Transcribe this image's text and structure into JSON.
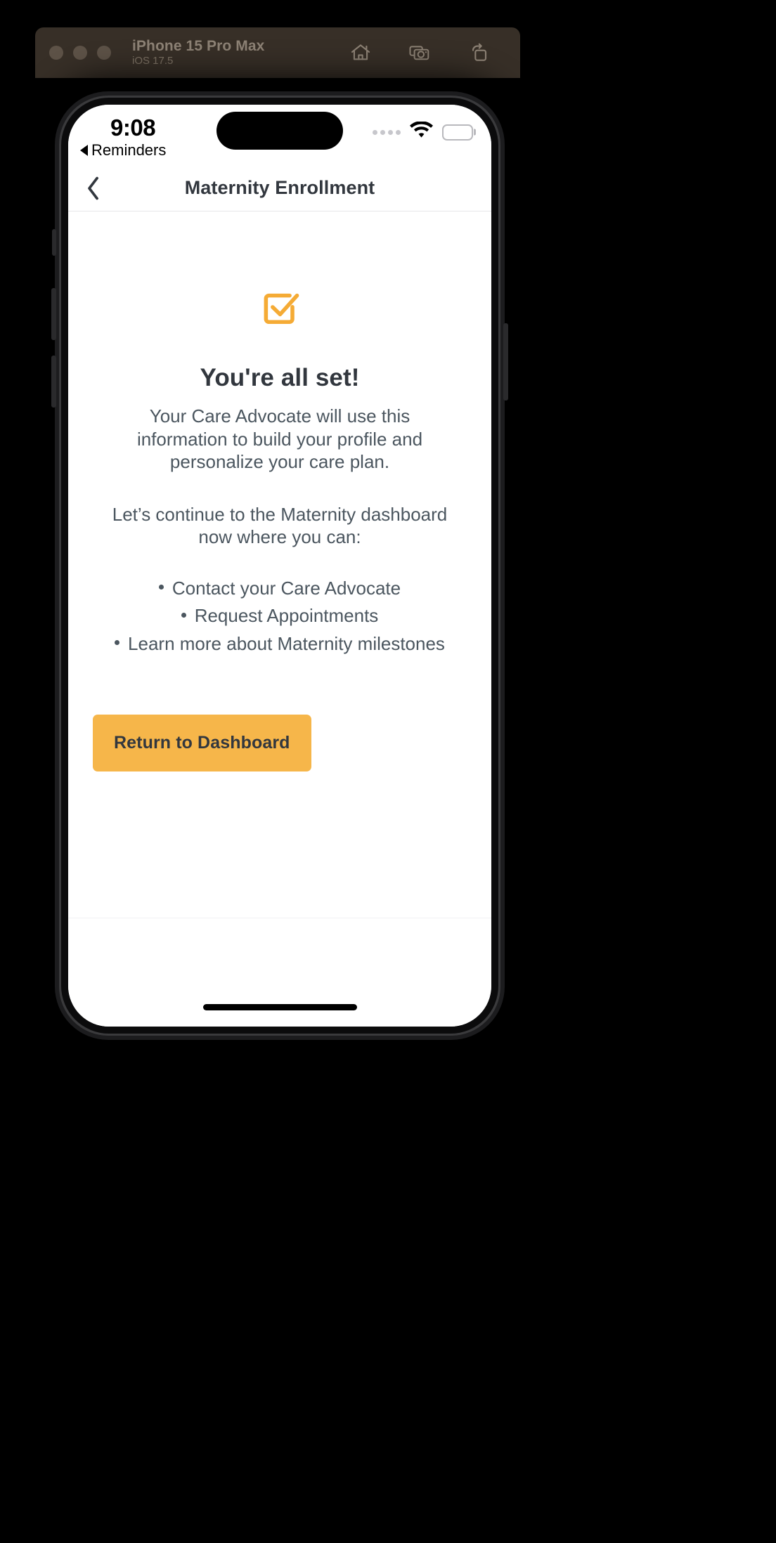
{
  "simulator": {
    "device_name": "iPhone 15 Pro Max",
    "os_version": "iOS 17.5",
    "window_controls": [
      "close-button",
      "minimize-button",
      "zoom-button"
    ],
    "toolbar_icons": [
      {
        "name": "home-icon",
        "label": "Home"
      },
      {
        "name": "screenshot-icon",
        "label": "Screenshot"
      },
      {
        "name": "rotate-icon",
        "label": "Rotate"
      }
    ],
    "chrome_color": "#372f27"
  },
  "status_bar": {
    "time": "9:08",
    "back_app_label": "Reminders",
    "wifi_icon": "wifi-icon",
    "battery_icon": "battery-icon",
    "cellular_icon": "cellular-dots-icon"
  },
  "nav_bar": {
    "back_icon": "chevron-left-icon",
    "title": "Maternity Enrollment"
  },
  "main": {
    "status_icon": "checkbox-check-icon",
    "accent_color": "#f5ab35",
    "headline": "You're all set!",
    "paragraph_1": "Your Care Advocate will use this information to build your profile and personalize your care plan.",
    "paragraph_2": "Let’s continue to the Maternity dashboard now where you can:",
    "bullets": [
      "Contact your Care Advocate",
      "Request Appointments",
      "Learn more about Maternity milestones"
    ],
    "cta_label": "Return to Dashboard",
    "cta_color": "#f6b64a",
    "text_color": "#4b565f",
    "heading_color": "#32373e"
  }
}
